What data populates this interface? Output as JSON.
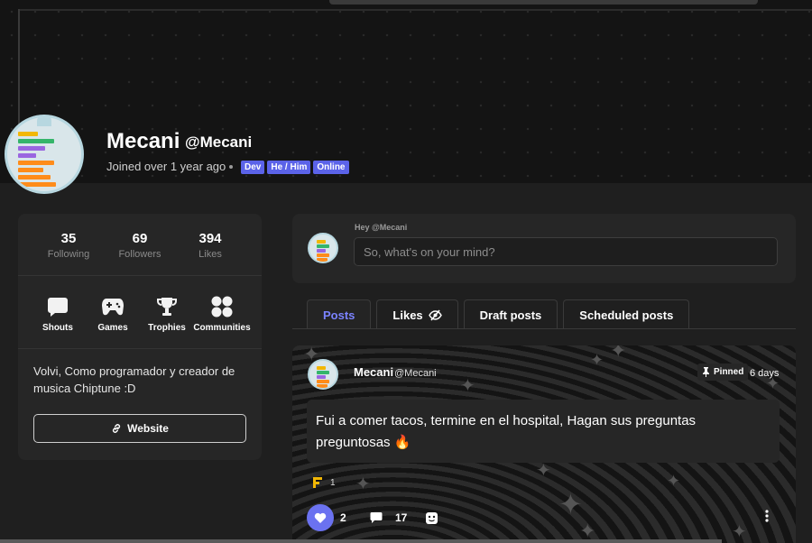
{
  "profile": {
    "name": "Mecani",
    "handle": "@Mecani",
    "joined": "Joined over 1 year ago",
    "badges": [
      "Dev",
      "He / Him",
      "Online"
    ]
  },
  "stats": [
    {
      "value": "35",
      "label": "Following"
    },
    {
      "value": "69",
      "label": "Followers"
    },
    {
      "value": "394",
      "label": "Likes"
    }
  ],
  "quick_links": [
    {
      "label": "Shouts",
      "icon": "shout-icon"
    },
    {
      "label": "Games",
      "icon": "gamepad-icon"
    },
    {
      "label": "Trophies",
      "icon": "trophy-icon"
    },
    {
      "label": "Communities",
      "icon": "communities-icon"
    }
  ],
  "bio": "Volvi, Como programador y creador de musica Chiptune :D",
  "website_label": "Website",
  "compose": {
    "greeting": "Hey @Mecani",
    "placeholder": "So, what's on your mind?"
  },
  "tabs": [
    {
      "label": "Posts",
      "active": true
    },
    {
      "label": "Likes",
      "active": false,
      "icon": "eye-slash-icon"
    },
    {
      "label": "Draft posts",
      "active": false
    },
    {
      "label": "Scheduled posts",
      "active": false
    }
  ],
  "post": {
    "author": "Mecani",
    "handle": "@Mecani",
    "pinned_label": "Pinned",
    "age": "6 days",
    "text": "Fui a comer tacos, termine en el hospital, Hagan sus preguntas preguntosas",
    "emoji": "🔥",
    "reaction_count": "1",
    "likes": "2",
    "comments": "17"
  },
  "colors": {
    "accent": "#6b72f0",
    "badge": "#5b63e8",
    "card": "#262626",
    "background": "#1f1f1f"
  }
}
